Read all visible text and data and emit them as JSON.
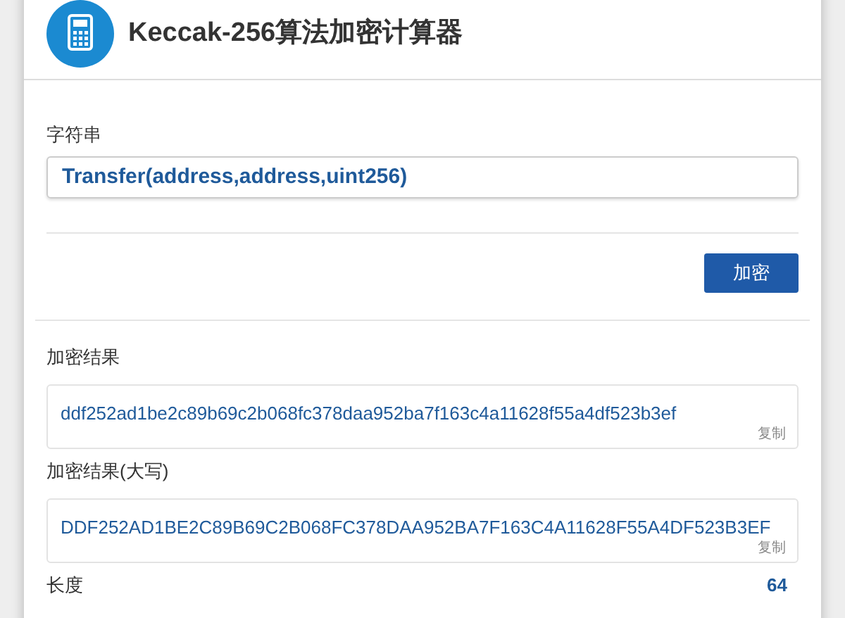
{
  "title": "Keccak-256算法加密计算器",
  "input": {
    "label": "字符串",
    "value": "Transfer(address,address,uint256)"
  },
  "encrypt_button": "加密",
  "results": [
    {
      "label": "加密结果",
      "value": "ddf252ad1be2c89b69c2b068fc378daa952ba7f163c4a11628f55a4df523b3ef",
      "copy": "复制"
    },
    {
      "label": "加密结果(大写)",
      "value": "DDF252AD1BE2C89B69C2B068FC378DAA952BA7F163C4A11628F55A4DF523B3EF",
      "copy": "复制"
    }
  ],
  "length": {
    "label": "长度",
    "value": "64"
  }
}
